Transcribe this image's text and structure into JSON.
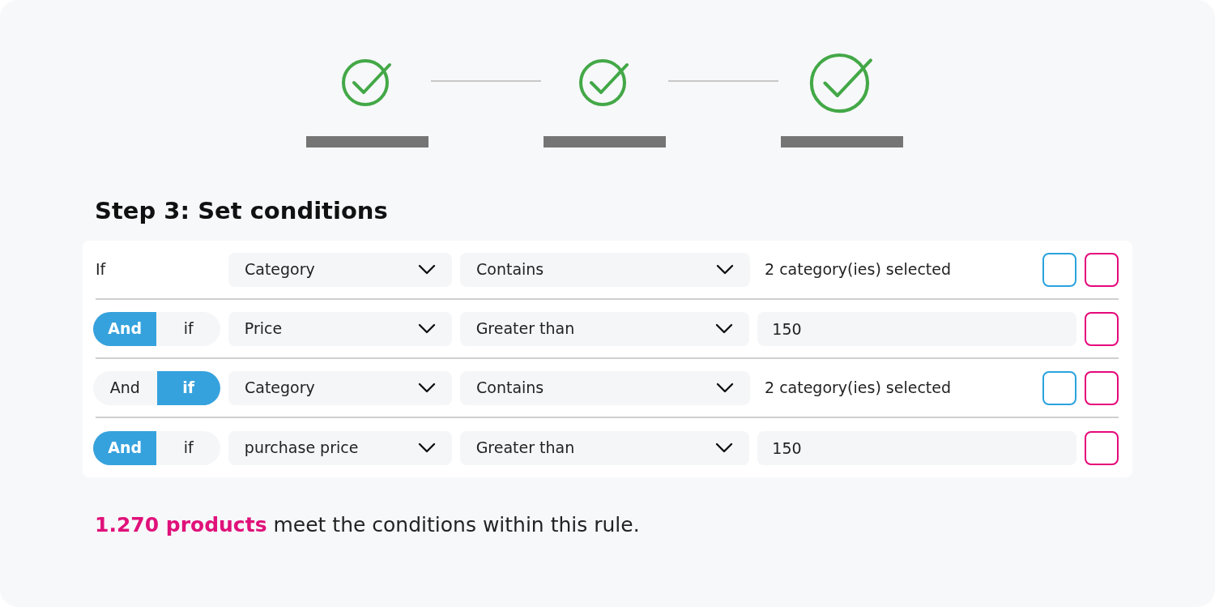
{
  "stepper": {
    "steps": [
      {
        "completed": true,
        "selected": false
      },
      {
        "completed": true,
        "selected": false
      },
      {
        "completed": true,
        "selected": true
      }
    ]
  },
  "heading": "Step 3: Set conditions",
  "conditions": [
    {
      "kind": "if",
      "label": "If",
      "field": "Category",
      "operator": "Contains",
      "value": {
        "kind": "selection",
        "text": "2 category(ies) selected"
      }
    },
    {
      "kind": "toggle",
      "options": [
        {
          "label": "And",
          "selected": true
        },
        {
          "label": "if",
          "selected": false
        }
      ],
      "field": "Price",
      "operator": "Greater than",
      "value": {
        "kind": "input",
        "text": "150"
      }
    },
    {
      "kind": "toggle",
      "options": [
        {
          "label": "And",
          "selected": false
        },
        {
          "label": "if",
          "selected": true
        }
      ],
      "field": "Category",
      "operator": "Contains",
      "value": {
        "kind": "selection",
        "text": "2 category(ies) selected"
      }
    },
    {
      "kind": "toggle",
      "options": [
        {
          "label": "And",
          "selected": true
        },
        {
          "label": "if",
          "selected": false
        }
      ],
      "field": "purchase price",
      "operator": "Greater than",
      "value": {
        "kind": "input",
        "text": "150"
      }
    }
  ],
  "result": "**1.270 products** meet the conditions within this rule."
}
